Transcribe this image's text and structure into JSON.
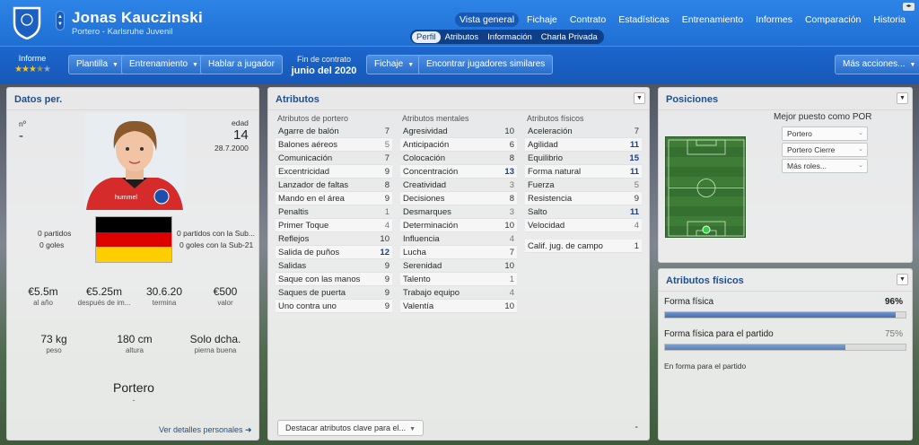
{
  "header": {
    "player_name": "Jonas Kauczinski",
    "player_sub": "Portero - Karlsruhe Juvenil",
    "nav": [
      "Vista general",
      "Fichaje",
      "Contrato",
      "Estadísticas",
      "Entrenamiento",
      "Informes",
      "Comparación",
      "Historia"
    ],
    "active_nav": "Vista general",
    "subnav": [
      "Perfil",
      "Atributos",
      "Información",
      "Charla Privada"
    ],
    "active_subnav": "Perfil"
  },
  "toolbar": {
    "informe_label": "Informe",
    "stars": 3.5,
    "plantilla": "Plantilla",
    "entrenamiento": "Entrenamiento",
    "hablar": "Hablar a jugador",
    "contract_label": "Fin de contrato",
    "contract_date": "junio del 2020",
    "fichaje": "Fichaje",
    "similares": "Encontrar jugadores similares",
    "mas_acciones": "Más acciones..."
  },
  "personal": {
    "title": "Datos per.",
    "num_label": "nº",
    "num_value": "-",
    "age_label": "edad",
    "age_value": "14",
    "birth_date": "28.7.2000",
    "matches_left": "0 partidos",
    "goals_left": "0 goles",
    "matches_u21": "0 partidos con la Sub...",
    "goals_u21": "0 goles con la Sub-21",
    "wage_value": "€5.5m",
    "wage_label": "al año",
    "value_value": "€5.25m",
    "value_label": "después de im...",
    "expires_value": "30.6.20",
    "expires_label": "termina",
    "price_value": "€500",
    "price_label": "valor",
    "weight_value": "73 kg",
    "weight_label": "peso",
    "height_value": "180 cm",
    "height_label": "altura",
    "foot_value": "Solo dcha.",
    "foot_label": "pierna buena",
    "position": "Portero",
    "position_sub": "-",
    "details_link": "Ver detalles personales ➜"
  },
  "attributes": {
    "title": "Atributos",
    "gk_head": "Atributos de portero",
    "mental_head": "Atributos mentales",
    "physical_head": "Atributos físicos",
    "goalkeeper": [
      {
        "name": "Agarre de balón",
        "value": 7
      },
      {
        "name": "Balones aéreos",
        "value": 5
      },
      {
        "name": "Comunicación",
        "value": 7
      },
      {
        "name": "Excentricidad",
        "value": 9
      },
      {
        "name": "Lanzador de faltas",
        "value": 8
      },
      {
        "name": "Mando en el área",
        "value": 9
      },
      {
        "name": "Penaltis",
        "value": 1
      },
      {
        "name": "Primer Toque",
        "value": 4
      },
      {
        "name": "Reflejos",
        "value": 10
      },
      {
        "name": "Salida de puños",
        "value": 12
      },
      {
        "name": "Salidas",
        "value": 9
      },
      {
        "name": "Saque con las manos",
        "value": 9
      },
      {
        "name": "Saques de puerta",
        "value": 9
      },
      {
        "name": "Uno contra uno",
        "value": 9
      }
    ],
    "mental": [
      {
        "name": "Agresividad",
        "value": 10
      },
      {
        "name": "Anticipación",
        "value": 6
      },
      {
        "name": "Colocación",
        "value": 8
      },
      {
        "name": "Concentración",
        "value": 13
      },
      {
        "name": "Creatividad",
        "value": 3
      },
      {
        "name": "Decisiones",
        "value": 8
      },
      {
        "name": "Desmarques",
        "value": 3
      },
      {
        "name": "Determinación",
        "value": 10
      },
      {
        "name": "Influencia",
        "value": 4
      },
      {
        "name": "Lucha",
        "value": 7
      },
      {
        "name": "Serenidad",
        "value": 10
      },
      {
        "name": "Talento",
        "value": 1
      },
      {
        "name": "Trabajo equipo",
        "value": 4
      },
      {
        "name": "Valentía",
        "value": 10
      }
    ],
    "physical": [
      {
        "name": "Aceleración",
        "value": 7
      },
      {
        "name": "Agilidad",
        "value": 11
      },
      {
        "name": "Equilibrio",
        "value": 15
      },
      {
        "name": "Forma natural",
        "value": 11
      },
      {
        "name": "Fuerza",
        "value": 5
      },
      {
        "name": "Resistencia",
        "value": 9
      },
      {
        "name": "Salto",
        "value": 11
      },
      {
        "name": "Velocidad",
        "value": 4
      }
    ],
    "field_rating_name": "Calif. jug. de campo",
    "field_rating_value": 1,
    "highlight_button": "Destacar atributos clave para el...",
    "corner_value": "-"
  },
  "positions": {
    "title": "Posiciones",
    "best_label": "Mejor puesto como POR",
    "roles": [
      "Portero",
      "Portero Cierre",
      "Más roles..."
    ]
  },
  "physical_panel": {
    "title": "Atributos físicos",
    "fitness_label": "Forma física",
    "fitness_pct": "96%",
    "fitness_value": 0.96,
    "match_label": "Forma física para el partido",
    "match_pct": "75%",
    "match_value": 0.75,
    "status": "En forma para el partido"
  },
  "colors": {
    "header_blue": "#1f6fd3",
    "accent_navy": "#1d4f91",
    "bar_fill": "#456fae",
    "star": "#f5c518"
  }
}
